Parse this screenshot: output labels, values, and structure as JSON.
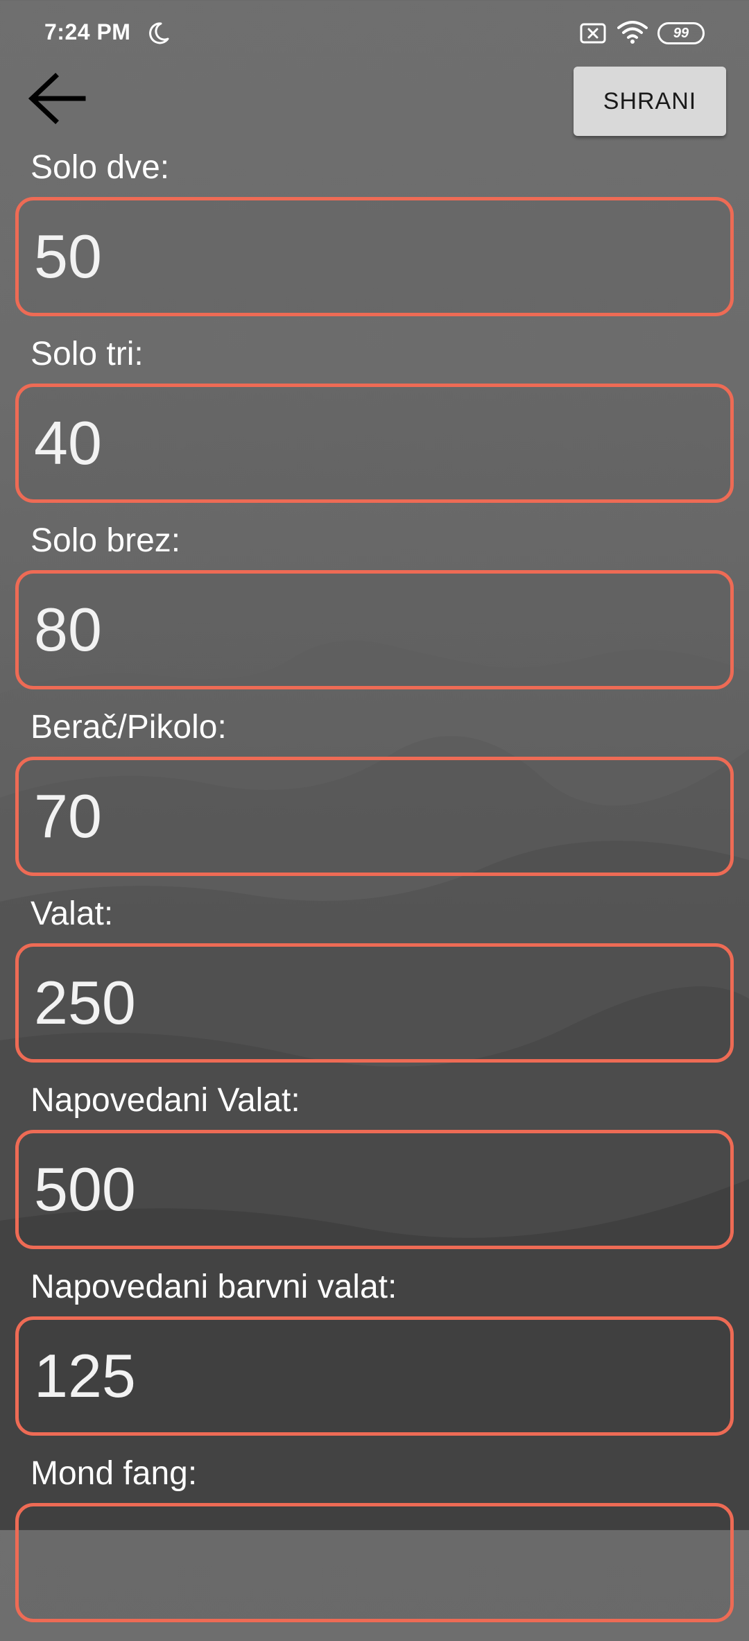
{
  "status_bar": {
    "time": "7:24 PM",
    "battery": "99",
    "icons": [
      "moon-icon",
      "sim-off-icon",
      "wifi-icon",
      "battery-icon"
    ]
  },
  "toolbar": {
    "back_icon": "arrow-left-icon",
    "save_label": "SHRANI"
  },
  "fields": [
    {
      "label": "Solo dve:",
      "value": "50"
    },
    {
      "label": "Solo tri:",
      "value": "40"
    },
    {
      "label": "Solo brez:",
      "value": "80"
    },
    {
      "label": "Berač/Pikolo:",
      "value": "70"
    },
    {
      "label": "Valat:",
      "value": "250"
    },
    {
      "label": "Napovedani Valat:",
      "value": "500"
    },
    {
      "label": "Napovedani barvni valat:",
      "value": "125"
    },
    {
      "label": "Mond fang:",
      "value": ""
    }
  ],
  "colors": {
    "accent_border": "#ee6b55",
    "button_bg": "#d9d9d9",
    "text": "#ffffff"
  }
}
